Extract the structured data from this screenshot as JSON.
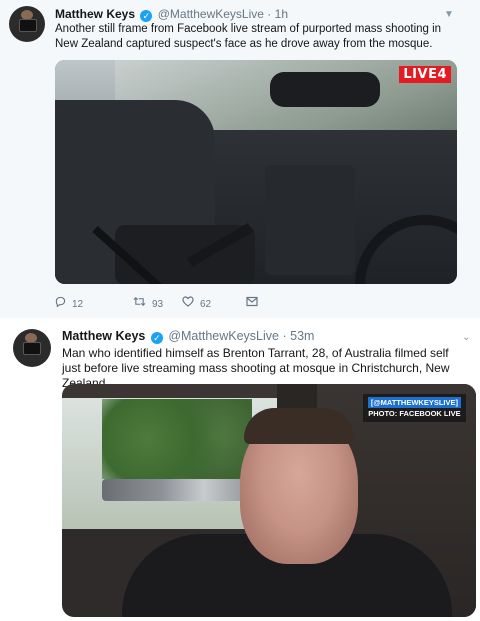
{
  "tweets": [
    {
      "name": "Matthew Keys",
      "handle": "@MatthewKeysLive",
      "separator": "·",
      "time": "1h",
      "text": "Another still frame from Facebook live stream of purported mass shooting in New Zealand captured suspect's face as he drove away from the mosque.",
      "media_overlay": "LIVE4",
      "actions": {
        "replies": "12",
        "retweets": "93",
        "likes": "62"
      },
      "icons": [
        "reply-icon",
        "retweet-icon",
        "like-icon",
        "message-icon"
      ]
    },
    {
      "name": "Matthew Keys",
      "handle": "@MatthewKeysLive",
      "separator": "·",
      "time": "53m",
      "text": "Man who identified himself as Brenton Tarrant, 28, of Australia filmed self just before live streaming mass shooting at mosque in Christchurch, New Zealand",
      "media_overlay_line1": "[@MATTHEWKEYSLIVE]",
      "media_overlay_line2": "PHOTO: FACEBOOK LIVE"
    }
  ],
  "colors": {
    "verified": "#1da1f2",
    "muted": "#657786",
    "live_red": "#e31b23"
  }
}
